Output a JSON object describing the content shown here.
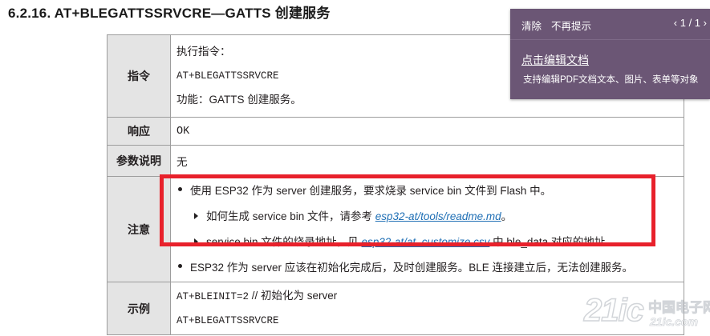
{
  "title": "6.2.16. AT+BLEGATTSSRVCRE—GATTS 创建服务",
  "table": {
    "rows": {
      "command": {
        "label": "指令",
        "lines": [
          "执行指令：",
          "AT+BLEGATTSSRVCRE",
          "功能：GATTS 创建服务。"
        ]
      },
      "response": {
        "label": "响应",
        "value": "OK"
      },
      "params": {
        "label": "参数说明",
        "value": "无"
      },
      "notes": {
        "label": "注意",
        "item1": "使用 ESP32 作为 server 创建服务，要求烧录 service bin 文件到 Flash 中。",
        "sub1": {
          "before": "如何生成 service bin 文件，请参考 ",
          "link": "esp32-at/tools/readme.md",
          "after": "。"
        },
        "sub2": {
          "before": "service bin 文件的烧录地址，见 ",
          "link": "esp32-at/at_customize.csv",
          "after": " 中 ble_data 对应的地址。"
        },
        "item2": "ESP32 作为 server 应该在初始化完成后，及时创建服务。BLE 连接建立后，无法创建服务。"
      },
      "example": {
        "label": "示例",
        "line1_cmd": "AT+BLEINIT=2",
        "line1_comment": "  // 初始化为 server",
        "line2": "AT+BLEGATTSSRVCRE"
      }
    }
  },
  "popup": {
    "clear_label": "清除",
    "dismiss_label": "不再提示",
    "prev_icon": "‹",
    "pager": "1 / 1",
    "next_icon": "›",
    "edit_link": "点击编辑文档",
    "description": "支持编辑PDF文档文本、图片、表单等对象",
    "bg_color": "#6b5675"
  },
  "watermark": {
    "brand": "21ic",
    "cn": "中国电子网",
    "sub": "21ic.com"
  },
  "colors": {
    "highlight_border": "#e8212b",
    "link": "#1f6fb5",
    "label_bg": "#e4e4e4"
  }
}
